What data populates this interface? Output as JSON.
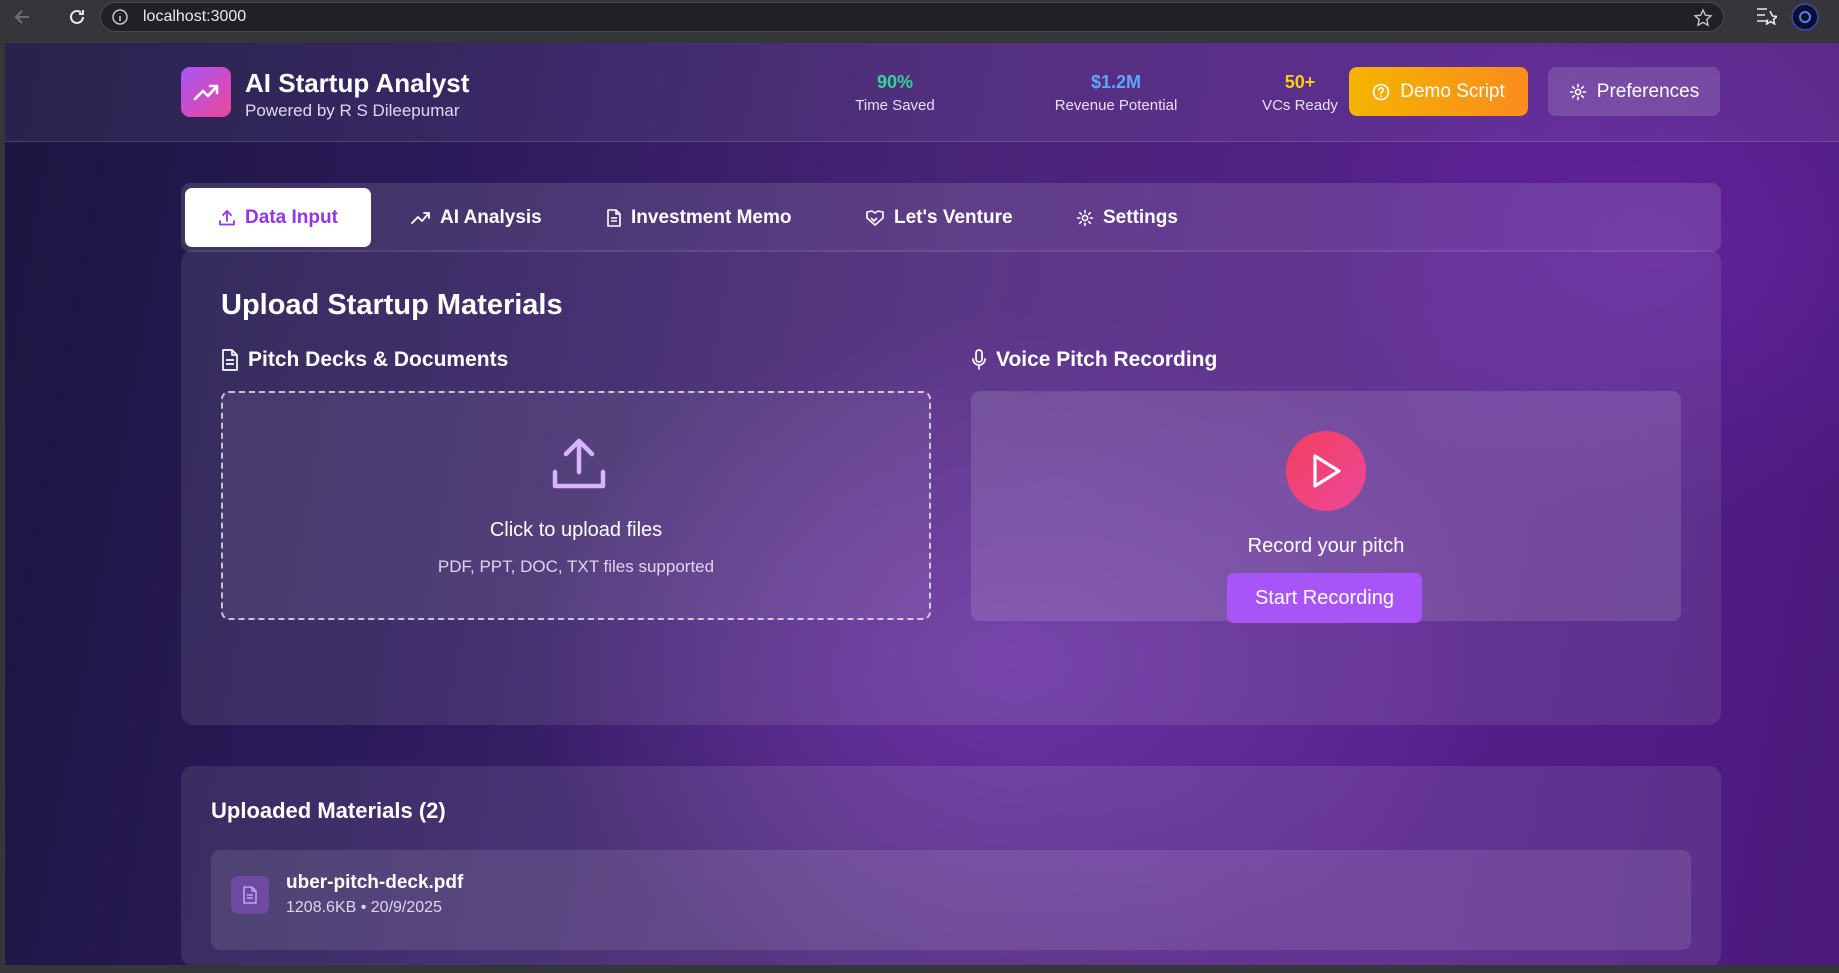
{
  "browser": {
    "url": "localhost:3000"
  },
  "header": {
    "title": "AI Startup Analyst",
    "subtitle": "Powered by R S Dileepumar",
    "stats": [
      {
        "value": "90%",
        "label": "Time Saved",
        "color": "#34d399"
      },
      {
        "value": "$1.2M",
        "label": "Revenue Potential",
        "color": "#60a5fa"
      },
      {
        "value": "50+",
        "label": "VCs Ready",
        "color": "#facc15"
      }
    ],
    "demo_label": "Demo Script",
    "preferences_label": "Preferences"
  },
  "tabs": [
    {
      "label": "Data Input",
      "icon": "upload-icon",
      "active": true
    },
    {
      "label": "AI Analysis",
      "icon": "trending-up-icon",
      "active": false
    },
    {
      "label": "Investment Memo",
      "icon": "document-icon",
      "active": false
    },
    {
      "label": "Let's Venture",
      "icon": "handshake-icon",
      "active": false
    },
    {
      "label": "Settings",
      "icon": "gear-icon",
      "active": false
    }
  ],
  "upload": {
    "title": "Upload Startup Materials",
    "docs_heading": "Pitch Decks & Documents",
    "drop_title": "Click to upload files",
    "drop_subtitle": "PDF, PPT, DOC, TXT files supported",
    "voice_heading": "Voice Pitch Recording",
    "record_label": "Record your pitch",
    "start_button": "Start Recording"
  },
  "materials": {
    "title": "Uploaded Materials (2)",
    "items": [
      {
        "name": "uber-pitch-deck.pdf",
        "meta": "1208.6KB • 20/9/2025"
      }
    ]
  },
  "colors": {
    "accent": "#a855f7",
    "active_tab_text": "#9333ea",
    "demo_gradient": [
      "#f4b400",
      "#fb8c1d"
    ],
    "record_gradient": [
      "#f43f5e",
      "#ec4899"
    ]
  }
}
